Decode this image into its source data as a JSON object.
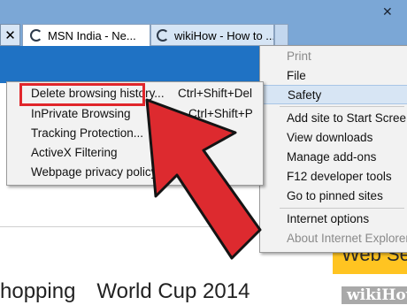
{
  "tabs": {
    "close_glyph": "✕",
    "active": {
      "label": "MSN India - Ne..."
    },
    "inactive": {
      "label": "wikiHow - How to ..."
    }
  },
  "window": {
    "close_glyph": "✕"
  },
  "tools_menu": {
    "items": [
      {
        "label": "Print",
        "disabled": true
      },
      {
        "label": "File"
      },
      {
        "label": "Safety",
        "highlighted": true
      },
      {
        "label": "Add site to Start Screen"
      },
      {
        "label": "View downloads"
      },
      {
        "label": "Manage add-ons"
      },
      {
        "label": "F12 developer tools"
      },
      {
        "label": "Go to pinned sites"
      },
      {
        "label": "Internet options"
      },
      {
        "label": "About Internet Explorer",
        "disabled": true
      }
    ]
  },
  "safety_menu": {
    "items": [
      {
        "label": "Delete browsing history...",
        "shortcut": "Ctrl+Shift+Del"
      },
      {
        "label": "InPrivate Browsing",
        "shortcut": "Ctrl+Shift+P"
      },
      {
        "label": "Tracking Protection...",
        "shortcut": ""
      },
      {
        "label": "ActiveX Filtering",
        "shortcut": ""
      },
      {
        "label": "Webpage privacy policy...",
        "shortcut": ""
      }
    ]
  },
  "page": {
    "search_button": "Web Sea",
    "footer_links": [
      "hopping",
      "World Cup 2014"
    ]
  },
  "watermark": "wikiHow",
  "colors": {
    "highlight_box": "#e0262b",
    "arrow": "#dd2a2f",
    "search_button": "#ffc421",
    "blue_strip": "#1f72c4"
  }
}
